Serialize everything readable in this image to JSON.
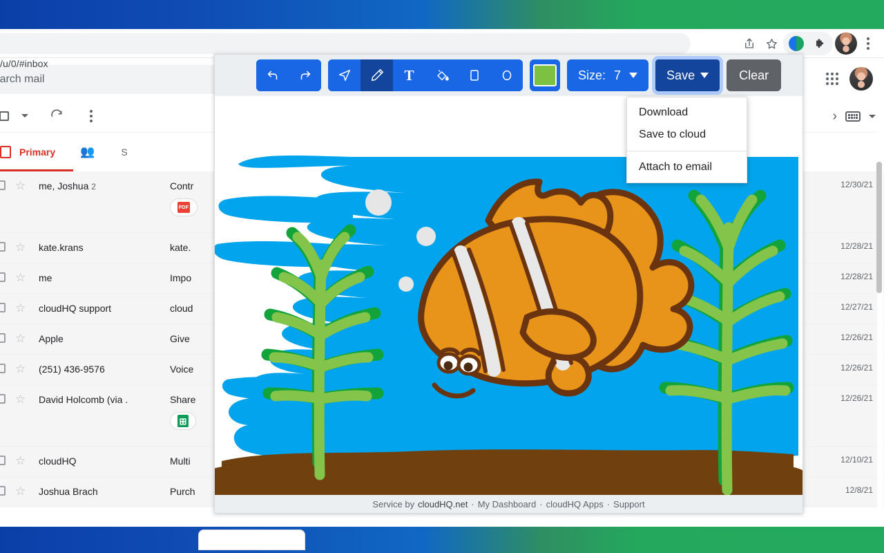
{
  "desktop": {
    "gradient_left": "#0b3fa8",
    "gradient_right": "#23aa5e"
  },
  "browser": {
    "url": "/u/0/#inbox",
    "icons": {
      "share": "share-icon",
      "bookmark": "star-icon",
      "extension_droplet": "cloudhq-extension-icon",
      "extension_puzzle": "extensions-puzzle-icon",
      "profile": "browser-profile-avatar",
      "menu": "three-dot-menu-icon"
    }
  },
  "gmail": {
    "search": {
      "placeholder": "Search mail",
      "icon": "search-icon"
    },
    "header_icons": {
      "apps": "apps-grid-icon",
      "account": "account-avatar"
    },
    "actions": {
      "select_all": "select-all-checkbox",
      "refresh": "refresh-icon",
      "more": "more-options-icon",
      "pager_next": "next-page-icon",
      "keyboard": "input-tools-icon"
    },
    "tabs": [
      {
        "label": "Primary",
        "icon": "inbox-icon",
        "active": true
      },
      {
        "label": "",
        "icon": "social-people-icon",
        "active": false
      },
      {
        "label": "S",
        "icon": "",
        "active": false
      }
    ],
    "rows": [
      {
        "sender": "me, Joshua",
        "count": "2",
        "subject": "Contr",
        "date": "12/30/21",
        "chip": "PDF",
        "chip_type": "pdf",
        "tall": true
      },
      {
        "sender": "kate.krans",
        "count": "",
        "subject": "kate.",
        "date": "12/28/21",
        "chip": "",
        "chip_type": "",
        "tall": false
      },
      {
        "sender": "me",
        "count": "",
        "subject": "Impo",
        "date": "12/28/21",
        "chip": "",
        "chip_type": "",
        "tall": false
      },
      {
        "sender": "cloudHQ support",
        "count": "",
        "subject": "cloud",
        "date": "12/27/21",
        "chip": "",
        "chip_type": "",
        "tall": false
      },
      {
        "sender": "Apple",
        "count": "",
        "subject": "Give",
        "date": "12/26/21",
        "chip": "",
        "chip_type": "",
        "tall": false
      },
      {
        "sender": "(251) 436-9576",
        "count": "",
        "subject": "Voice",
        "date": "12/26/21",
        "chip": "",
        "chip_type": "",
        "tall": false
      },
      {
        "sender": "David Holcomb (via .",
        "count": "",
        "subject": "Share",
        "date": "12/26/21",
        "chip": "",
        "chip_type": "sheet",
        "tall": true
      },
      {
        "sender": "cloudHQ",
        "count": "",
        "subject": "Multi",
        "date": "12/10/21",
        "chip": "",
        "chip_type": "",
        "tall": false
      },
      {
        "sender": "Joshua Brach",
        "count": "",
        "subject": "Purch",
        "date": "12/8/21",
        "chip": "",
        "chip_type": "",
        "tall": false
      }
    ]
  },
  "draw_app": {
    "toolbar": {
      "undo": "undo-icon",
      "redo": "redo-icon",
      "select": "cursor-arrow-icon",
      "pencil": "pencil-icon",
      "text": "T",
      "fill": "paint-bucket-icon",
      "rectangle": "rectangle-icon",
      "ellipse": "ellipse-icon",
      "color_value": "#7cc142",
      "size_label": "Size:",
      "size_value": "7",
      "save_label": "Save",
      "clear_label": "Clear"
    },
    "save_menu": {
      "download": "Download",
      "save_to_cloud": "Save to cloud",
      "attach_to_email": "Attach to email"
    },
    "footer": {
      "prefix": "Service by",
      "brand": "cloudHQ.net",
      "dot1": "·",
      "dashboard": "My Dashboard",
      "dot2": "·",
      "apps": "cloudHQ Apps",
      "dot3": "·",
      "support": "Support"
    },
    "canvas": {
      "description": "clownfish-underwater-drawing",
      "water_color": "#02a5ed",
      "sand_color": "#70400f",
      "fish_body_color": "#e8941a",
      "fish_outline_color": "#6b3410",
      "fish_stripe_color": "#e8e8e8",
      "plant_light_green": "#84c44b",
      "plant_dark_green": "#12a43a",
      "bubble_color": "#e6e6e6"
    }
  }
}
